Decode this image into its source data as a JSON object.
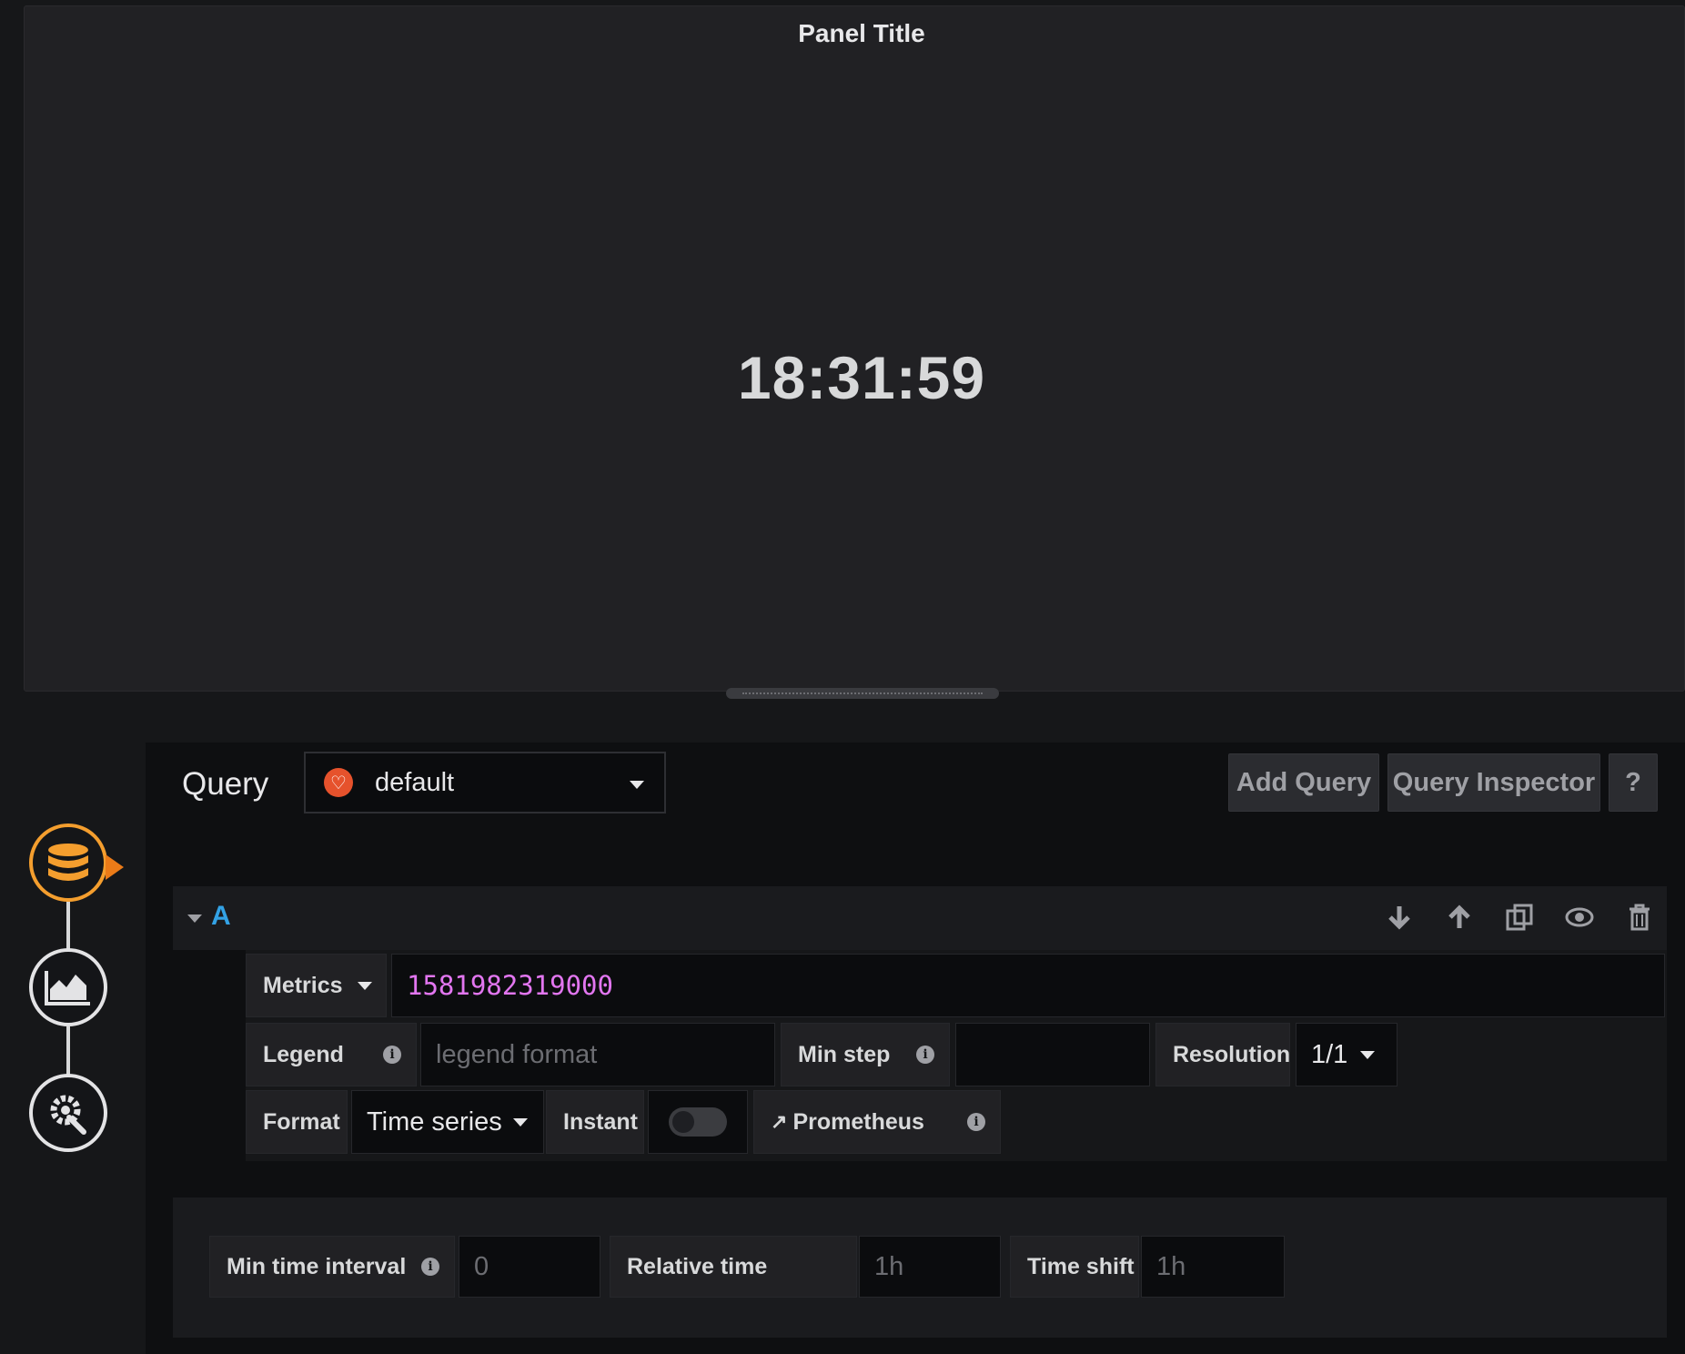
{
  "panel": {
    "title": "Panel Title",
    "value": "18:31:59"
  },
  "header": {
    "query_label": "Query",
    "datasource": "default",
    "add_query": "Add Query",
    "query_inspector": "Query Inspector",
    "help": "?"
  },
  "sidenav": {
    "items": [
      "queries-icon",
      "visualization-icon",
      "general-settings-icon"
    ]
  },
  "query": {
    "ref_id": "A",
    "metrics_label": "Metrics",
    "metrics_value": "1581982319000",
    "legend_label": "Legend",
    "legend_placeholder": "legend format",
    "min_step_label": "Min step",
    "resolution_label": "Resolution",
    "resolution_value": "1/1",
    "format_label": "Format",
    "format_value": "Time series",
    "instant_label": "Instant",
    "instant_on": false,
    "prometheus_link": "Prometheus"
  },
  "options": {
    "min_interval_label": "Min time interval",
    "min_interval_placeholder": "0",
    "relative_time_label": "Relative time",
    "relative_time_placeholder": "1h",
    "time_shift_label": "Time shift",
    "time_shift_placeholder": "1h"
  },
  "colors": {
    "accent": "#f49e2e",
    "metrics_text": "#e276f0",
    "ref_letter": "#33a2e5"
  }
}
